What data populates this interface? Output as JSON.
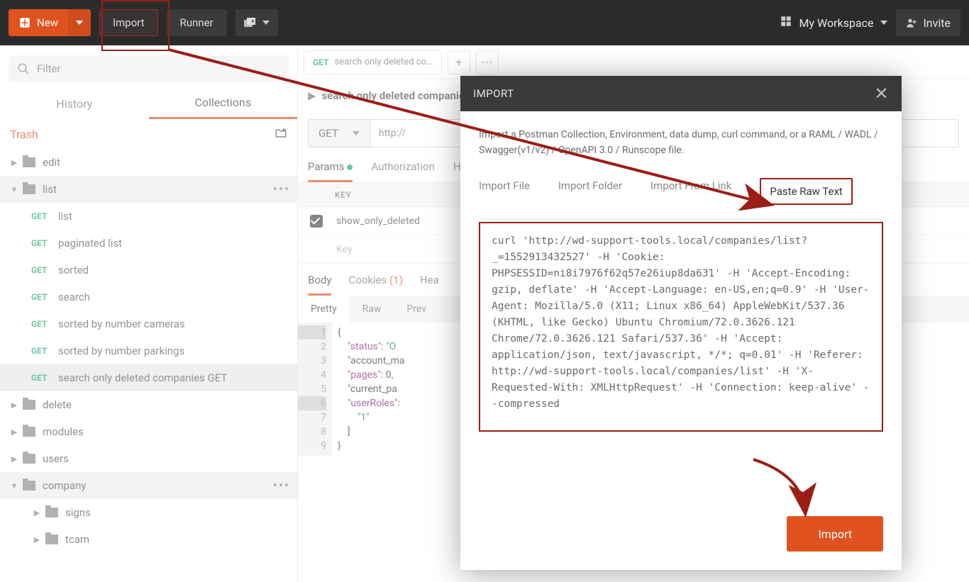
{
  "topbar": {
    "new_label": "New",
    "import_label": "Import",
    "runner_label": "Runner",
    "workspace_label": "My Workspace",
    "invite_label": "Invite"
  },
  "sidebar": {
    "filter_placeholder": "Filter",
    "tab_history": "History",
    "tab_collections": "Collections",
    "trash_label": "Trash",
    "tree": {
      "edit": "edit",
      "list": "list",
      "list_items": [
        {
          "method": "GET",
          "label": "list"
        },
        {
          "method": "GET",
          "label": "paginated list"
        },
        {
          "method": "GET",
          "label": "sorted"
        },
        {
          "method": "GET",
          "label": "search"
        },
        {
          "method": "GET",
          "label": "sorted by number cameras"
        },
        {
          "method": "GET",
          "label": "sorted by number parkings"
        },
        {
          "method": "GET",
          "label": "search only deleted companies GET"
        }
      ],
      "delete": "delete",
      "modules": "modules",
      "users": "users",
      "company": "company",
      "company_children": [
        "signs",
        "tcam"
      ]
    }
  },
  "main": {
    "open_tab": {
      "method": "GET",
      "label": "search only deleted co…"
    },
    "req_title": "search only deleted companies GET",
    "method": "GET",
    "url": "http://",
    "subtabs": {
      "params": "Params",
      "auth": "Authorization",
      "headers": "Hea"
    },
    "param_header": "KEY",
    "param_rows": [
      {
        "checked": true,
        "key": "show_only_deleted"
      },
      {
        "checked": false,
        "key": "Key"
      }
    ],
    "resp_tabs": {
      "body": "Body",
      "cookies": "Cookies",
      "cookies_count": "(1)",
      "headers": "Hea"
    },
    "view_tabs": {
      "pretty": "Pretty",
      "raw": "Raw",
      "preview": "Prev"
    },
    "code_lines": [
      "{",
      "    \"status\": \"O",
      "    \"account_ma",
      "    \"pages\": 0,",
      "    \"current_pa",
      "    \"userRoles\":",
      "        \"1\"",
      "    ]",
      "}"
    ],
    "code_line_nums": [
      "1",
      "2",
      "3",
      "4",
      "5",
      "6",
      "7",
      "8",
      "9"
    ]
  },
  "modal": {
    "title": "IMPORT",
    "desc": "Import a Postman Collection, Environment, data dump, curl command, or a RAML / WADL / Swagger(v1/v2) / OpenAPI 3.0 / Runscope file.",
    "tabs": {
      "file": "Import File",
      "folder": "Import Folder",
      "link": "Import From Link",
      "raw": "Paste Raw Text"
    },
    "raw_text": "curl 'http://wd-support-tools.local/companies/list?_=1552913432527' -H 'Cookie: PHPSESSID=ni8i7976f62q57e26iup8da631' -H 'Accept-Encoding: gzip, deflate' -H 'Accept-Language: en-US,en;q=0.9' -H 'User-Agent: Mozilla/5.0 (X11; Linux x86_64) AppleWebKit/537.36 (KHTML, like Gecko) Ubuntu Chromium/72.0.3626.121 Chrome/72.0.3626.121 Safari/537.36' -H 'Accept: application/json, text/javascript, */*; q=0.01' -H 'Referer: http://wd-support-tools.local/companies/list' -H 'X-Requested-With: XMLHttpRequest' -H 'Connection: keep-alive' --compressed",
    "import_button": "Import"
  }
}
